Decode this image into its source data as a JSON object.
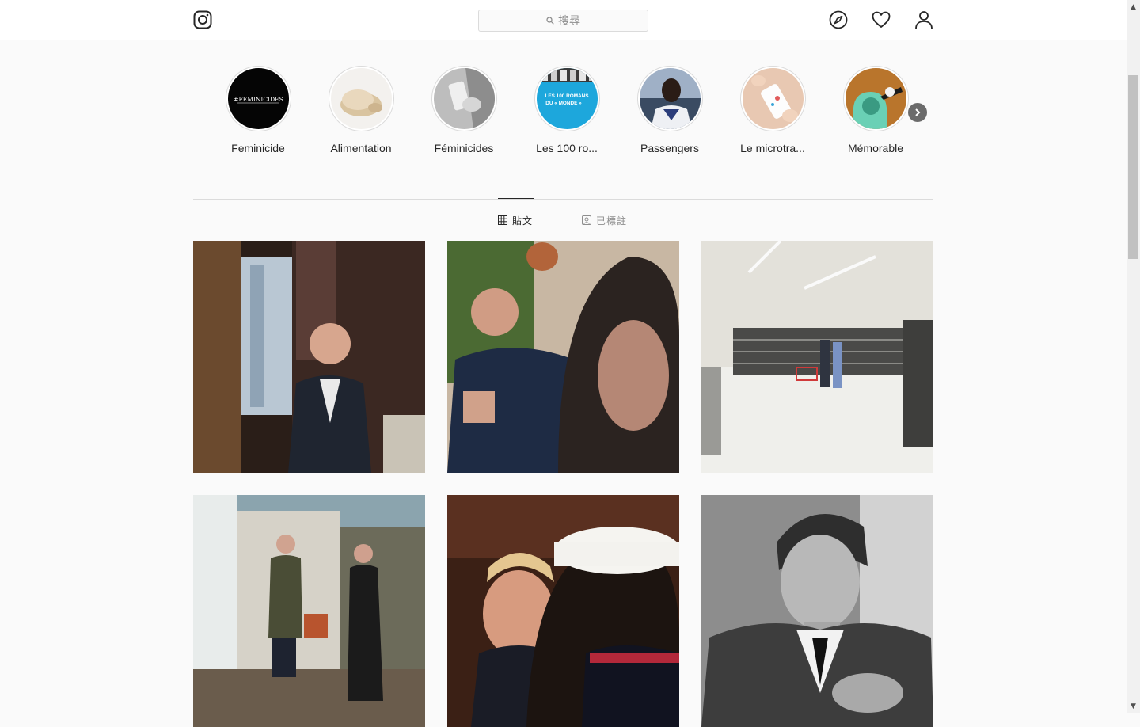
{
  "search": {
    "placeholder": "搜尋"
  },
  "highlights": [
    {
      "label": "Feminicide",
      "cover_text": "#FEMINICIDES"
    },
    {
      "label": "Alimentation"
    },
    {
      "label": "Féminicides"
    },
    {
      "label": "Les 100 ro...",
      "cover_text_line1": "LES 100 ROMANS",
      "cover_text_line2": "DU « MONDE »"
    },
    {
      "label": "Passengers"
    },
    {
      "label": "Le microtra..."
    },
    {
      "label": "Mémorable"
    }
  ],
  "tabs": [
    {
      "label": "貼文",
      "active": true
    },
    {
      "label": "已標註",
      "active": false
    }
  ],
  "icons": {
    "logo": "instagram-logo-icon",
    "explore": "compass-icon",
    "activity": "heart-icon",
    "profile": "user-icon"
  },
  "colors": {
    "border": "#dbdbdb",
    "background": "#fafafa",
    "text": "#262626",
    "muted": "#8e8e8e"
  }
}
